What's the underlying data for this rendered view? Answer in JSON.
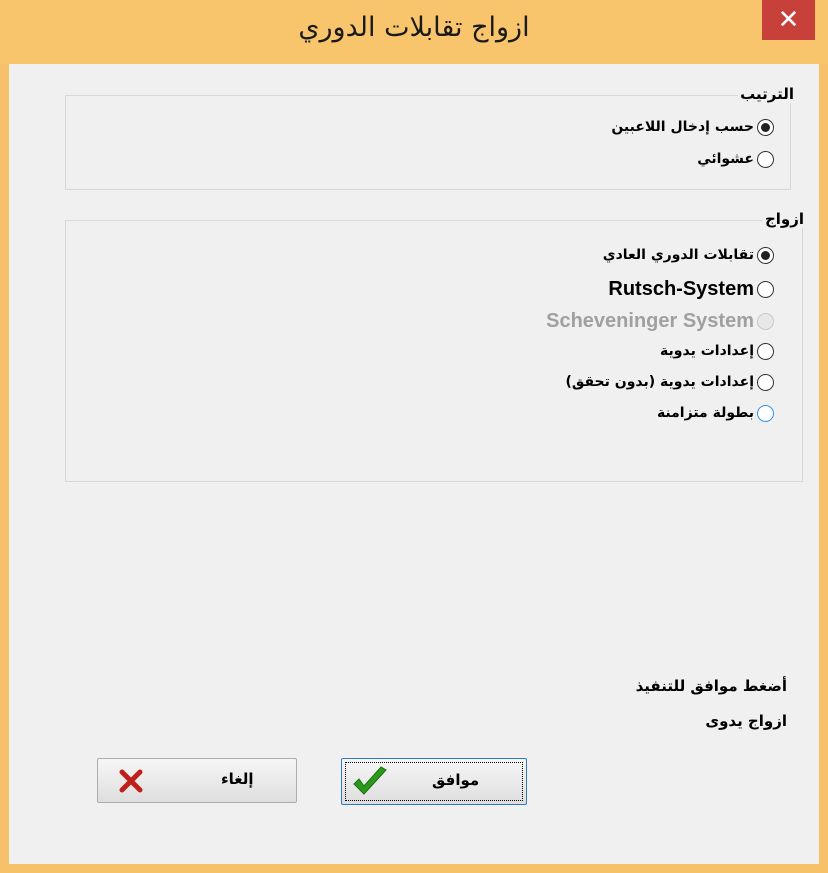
{
  "window": {
    "title": "ازواج تقابلات الدوري",
    "close_glyph": "✕"
  },
  "ordering": {
    "caption": "الترتيب",
    "options": [
      {
        "label": "حسب إدخال اللاعبين",
        "checked": true
      },
      {
        "label": "عشوائي",
        "checked": false
      }
    ]
  },
  "pairing": {
    "caption": "ازواج",
    "options": [
      {
        "label": "تقابلات الدوري العادي",
        "checked": true
      },
      {
        "label": "Rutsch-System",
        "checked": false
      },
      {
        "label": "Scheveninger System",
        "checked": false,
        "disabled": true
      },
      {
        "label": "إعدادات يدوية",
        "checked": false
      },
      {
        "label": "إعدادات يدوية (بدون تحقق)",
        "checked": false
      },
      {
        "label": "بطولة متزامنة",
        "checked": false
      }
    ]
  },
  "info": {
    "line1": "أضغط موافق للتنفيذ",
    "line2": "ازواج يدوى"
  },
  "buttons": {
    "ok_label": "موافق",
    "cancel_label": "إلغاء"
  },
  "icons": {
    "ok": "check-icon",
    "cancel": "x-icon",
    "ok_color": "#2a9a1a",
    "cancel_color": "#c0201a"
  }
}
